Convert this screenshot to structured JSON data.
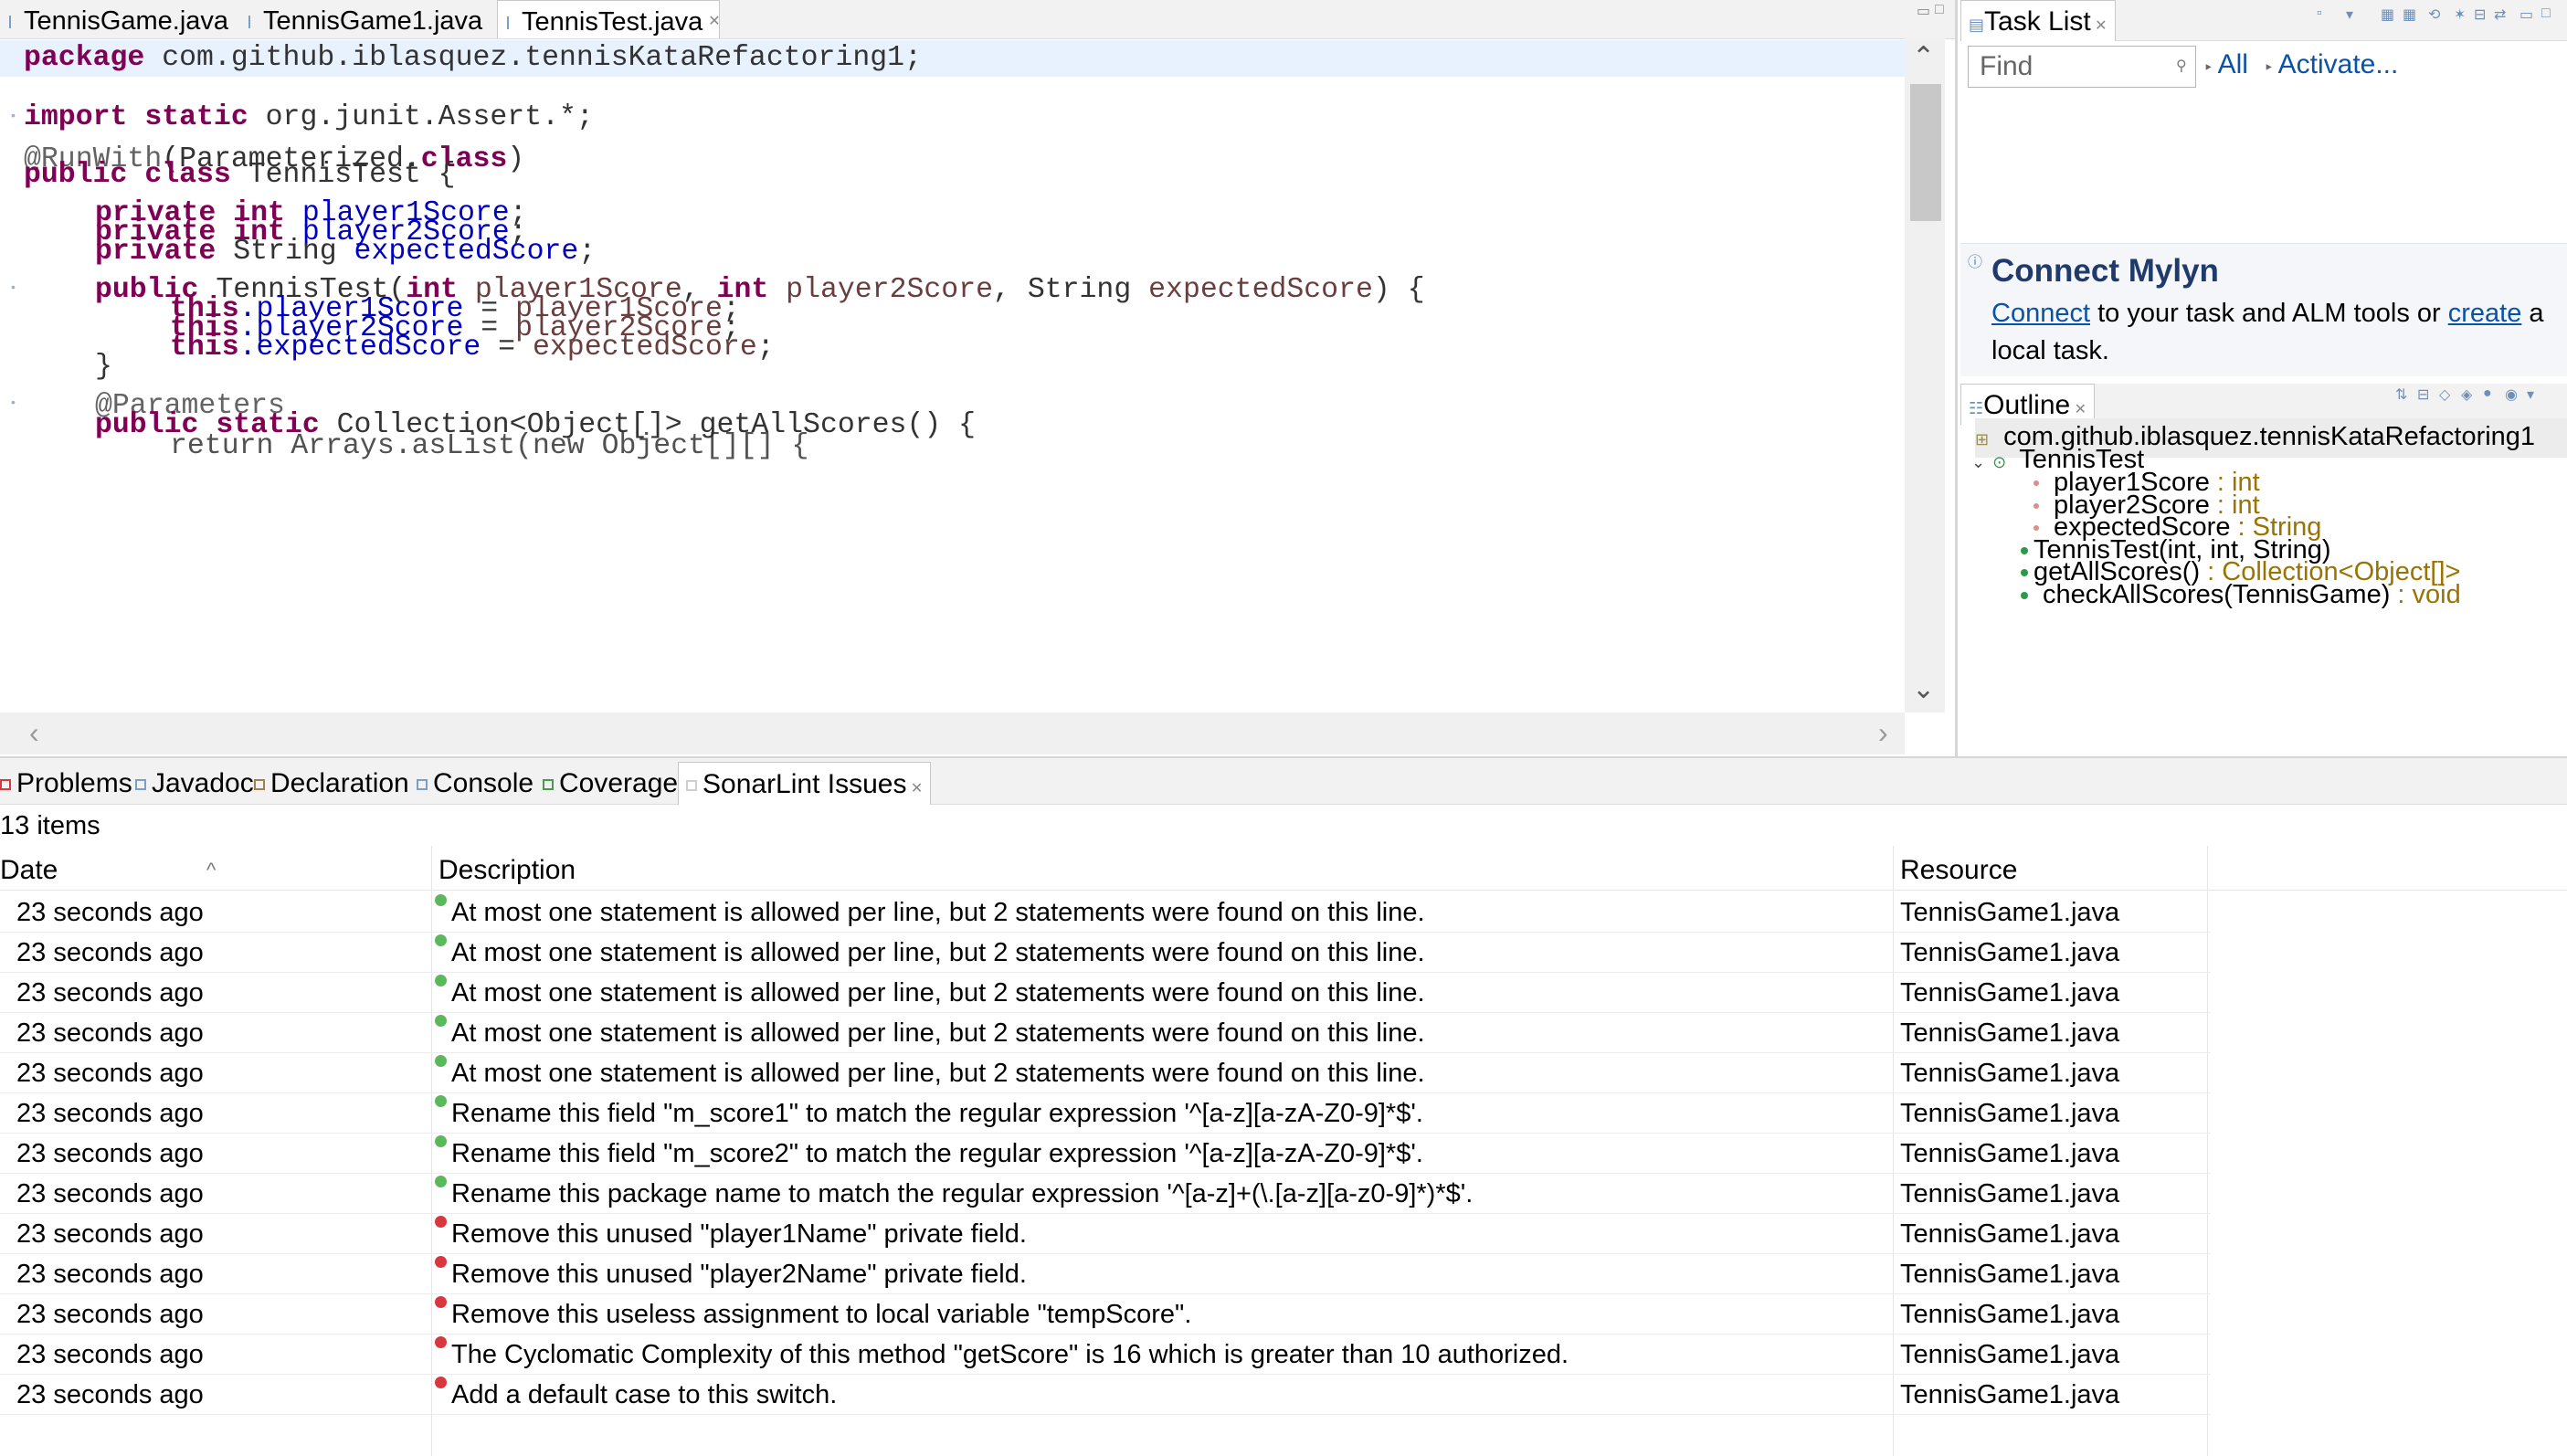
{
  "editor": {
    "tabs": [
      {
        "label": "TennisGame.java"
      },
      {
        "label": "TennisGame1.java"
      },
      {
        "label": "TennisTest.java"
      }
    ],
    "code": {
      "line1_kw": "package",
      "line1_rest": " com.github.iblasquez.tennisKataRefactoring1;",
      "line2_kw1": "import",
      "line2_kw2": " static",
      "line2_rest": " org.junit.Assert.*;",
      "line3_ann": "@RunWith",
      "line3_mid": "(Parameterized.",
      "line3_kw": "class",
      "line3_end": ")",
      "line4_kw1": "public",
      "line4_kw2": " class",
      "line4_rest": " TennisTest {",
      "f1_kw1": "private",
      "f1_kw2": " int",
      "f1_name": " player1Score",
      "f1_end": ";",
      "f2_kw1": "private",
      "f2_kw2": " int",
      "f2_name": " player2Score",
      "f2_end": ";",
      "f3_kw1": "private",
      "f3_type": " String",
      "f3_name": " expectedScore",
      "f3_end": ";",
      "c_kw": "public",
      "c_name": " TennisTest(",
      "c_int1": "int",
      "c_p1": " player1Score",
      "c_comma1": ", ",
      "c_int2": "int",
      "c_p2": " player2Score",
      "c_str": ", String",
      "c_p3": " expectedScore",
      "c_end": ") {",
      "a1_this": "this",
      "a1_fld": ".player1Score",
      "a1_eq": " = ",
      "a1_par": "player1Score",
      "a1_end": ";",
      "a2_this": "this",
      "a2_fld": ".player2Score",
      "a2_eq": " = ",
      "a2_par": "player2Score",
      "a2_end": ";",
      "a3_this": "this",
      "a3_fld": ".expectedScore",
      "a3_eq": " = ",
      "a3_par": "expectedScore",
      "a3_end": ";",
      "close_brace": "}",
      "p_ann": "@Parameters",
      "m_kw1": "public",
      "m_kw2": " static",
      "m_rest": " Collection<Object[]> getAllScores() {",
      "partial": "return Arrays.asList(new Object[][] {"
    }
  },
  "tasklist": {
    "tab_label": "Task List",
    "find_placeholder": "Find",
    "all_link": "All",
    "activate_link": "Activate...",
    "mylyn_title": "Connect Mylyn",
    "mylyn_connect": "Connect",
    "mylyn_text1": " to your task and ALM tools or ",
    "mylyn_create": "create",
    "mylyn_text2": " a local task."
  },
  "outline": {
    "tab_label": "Outline",
    "package": "com.github.iblasquez.tennisKataRefactoring1",
    "class_name": "TennisTest",
    "members": [
      {
        "name": "player1Score",
        "type": " : int"
      },
      {
        "name": "player2Score",
        "type": " : int"
      },
      {
        "name": "expectedScore",
        "type": " : String"
      },
      {
        "name": "TennisTest(int, int, String)",
        "type": ""
      },
      {
        "name": "getAllScores()",
        "type": " : Collection<Object[]>"
      },
      {
        "name": "checkAllScores(TennisGame)",
        "type": " : void"
      }
    ]
  },
  "bottom": {
    "tabs": [
      {
        "label": "Problems"
      },
      {
        "label": "Javadoc"
      },
      {
        "label": "Declaration"
      },
      {
        "label": "Console"
      },
      {
        "label": "Coverage"
      },
      {
        "label": "SonarLint Issues"
      }
    ],
    "item_count": "13 items",
    "columns": {
      "date": "Date",
      "description": "Description",
      "resource": "Resource"
    },
    "issues": [
      {
        "date": "23 seconds ago",
        "severity": "minor",
        "description": "At most one statement is allowed per line, but 2 statements were found on this line.",
        "resource": "TennisGame1.java"
      },
      {
        "date": "23 seconds ago",
        "severity": "minor",
        "description": "At most one statement is allowed per line, but 2 statements were found on this line.",
        "resource": "TennisGame1.java"
      },
      {
        "date": "23 seconds ago",
        "severity": "minor",
        "description": "At most one statement is allowed per line, but 2 statements were found on this line.",
        "resource": "TennisGame1.java"
      },
      {
        "date": "23 seconds ago",
        "severity": "minor",
        "description": "At most one statement is allowed per line, but 2 statements were found on this line.",
        "resource": "TennisGame1.java"
      },
      {
        "date": "23 seconds ago",
        "severity": "minor",
        "description": "At most one statement is allowed per line, but 2 statements were found on this line.",
        "resource": "TennisGame1.java"
      },
      {
        "date": "23 seconds ago",
        "severity": "minor",
        "description": "Rename this field \"m_score1\" to match the regular expression '^[a-z][a-zA-Z0-9]*$'.",
        "resource": "TennisGame1.java"
      },
      {
        "date": "23 seconds ago",
        "severity": "minor",
        "description": "Rename this field \"m_score2\" to match the regular expression '^[a-z][a-zA-Z0-9]*$'.",
        "resource": "TennisGame1.java"
      },
      {
        "date": "23 seconds ago",
        "severity": "minor",
        "description": "Rename this package name to match the regular expression '^[a-z]+(\\.[a-z][a-z0-9]*)*$'.",
        "resource": "TennisGame1.java"
      },
      {
        "date": "23 seconds ago",
        "severity": "major",
        "description": "Remove this unused \"player1Name\" private field.",
        "resource": "TennisGame1.java"
      },
      {
        "date": "23 seconds ago",
        "severity": "major",
        "description": "Remove this unused \"player2Name\" private field.",
        "resource": "TennisGame1.java"
      },
      {
        "date": "23 seconds ago",
        "severity": "major",
        "description": "Remove this useless assignment to local variable \"tempScore\".",
        "resource": "TennisGame1.java"
      },
      {
        "date": "23 seconds ago",
        "severity": "major",
        "description": "The Cyclomatic Complexity of this method \"getScore\" is 16 which is greater than 10 authorized.",
        "resource": "TennisGame1.java"
      },
      {
        "date": "23 seconds ago",
        "severity": "major",
        "description": "Add a default case to this switch.",
        "resource": "TennisGame1.java"
      }
    ]
  }
}
